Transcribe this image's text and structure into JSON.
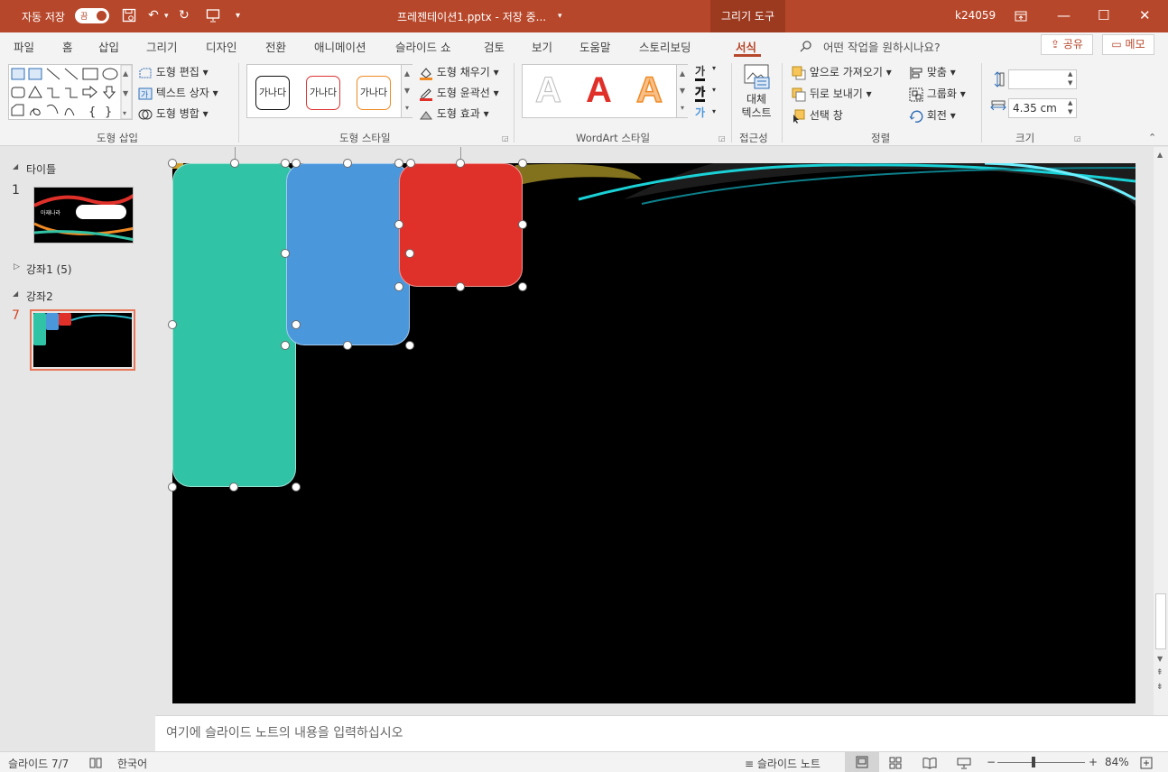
{
  "titlebar": {
    "autosave_label": "자동 저장",
    "autosave_state": "끔",
    "document_title": "프레젠테이션1.pptx - 저장 중...",
    "context_tab": "그리기 도구",
    "user": "k24059"
  },
  "menu": {
    "tabs": [
      "파일",
      "홈",
      "삽입",
      "그리기",
      "디자인",
      "전환",
      "애니메이션",
      "슬라이드 쇼",
      "검토",
      "보기",
      "도움말",
      "스토리보딩",
      "서식"
    ],
    "active_tab": "서식",
    "tell_me": "어떤 작업을 원하시나요?",
    "share": "공유",
    "comments": "메모"
  },
  "ribbon": {
    "insert_shapes": {
      "label": "도형 삽입",
      "edit_shape": "도형 편집",
      "text_box": "텍스트 상자",
      "merge_shapes": "도형 병합"
    },
    "shape_styles": {
      "label": "도형 스타일",
      "preset_text": "가나다",
      "fill": "도형 채우기",
      "outline": "도형 윤곽선",
      "effects": "도형 효과"
    },
    "wordart": {
      "label": "WordArt 스타일",
      "letter": "A",
      "text_glyph": "가"
    },
    "accessibility": {
      "label": "접근성",
      "alt_text_line1": "대체",
      "alt_text_line2": "텍스트"
    },
    "arrange": {
      "label": "정렬",
      "bring_forward": "앞으로 가져오기",
      "send_backward": "뒤로 보내기",
      "selection_pane": "선택 창",
      "align": "맞춤",
      "group": "그룹화",
      "rotate": "회전"
    },
    "size": {
      "label": "크기",
      "height": "",
      "width": "4.35 cm"
    }
  },
  "slides_panel": {
    "section1": "타이틀",
    "slide1_number": "1",
    "slide1_caption": "아재나라",
    "section2": "강좌1 (5)",
    "section3": "강좌2",
    "slide7_number": "7"
  },
  "slide": {
    "shape_colors": [
      "#31c3a5",
      "#4a97dc",
      "#e0302a"
    ]
  },
  "notes_placeholder": "여기에 슬라이드 노트의 내용을 입력하십시오",
  "status": {
    "slide_count": "슬라이드 7/7",
    "language": "한국어",
    "notes": "슬라이드 노트",
    "zoom": "84%"
  },
  "colors": {
    "accent": "#b7472a"
  }
}
